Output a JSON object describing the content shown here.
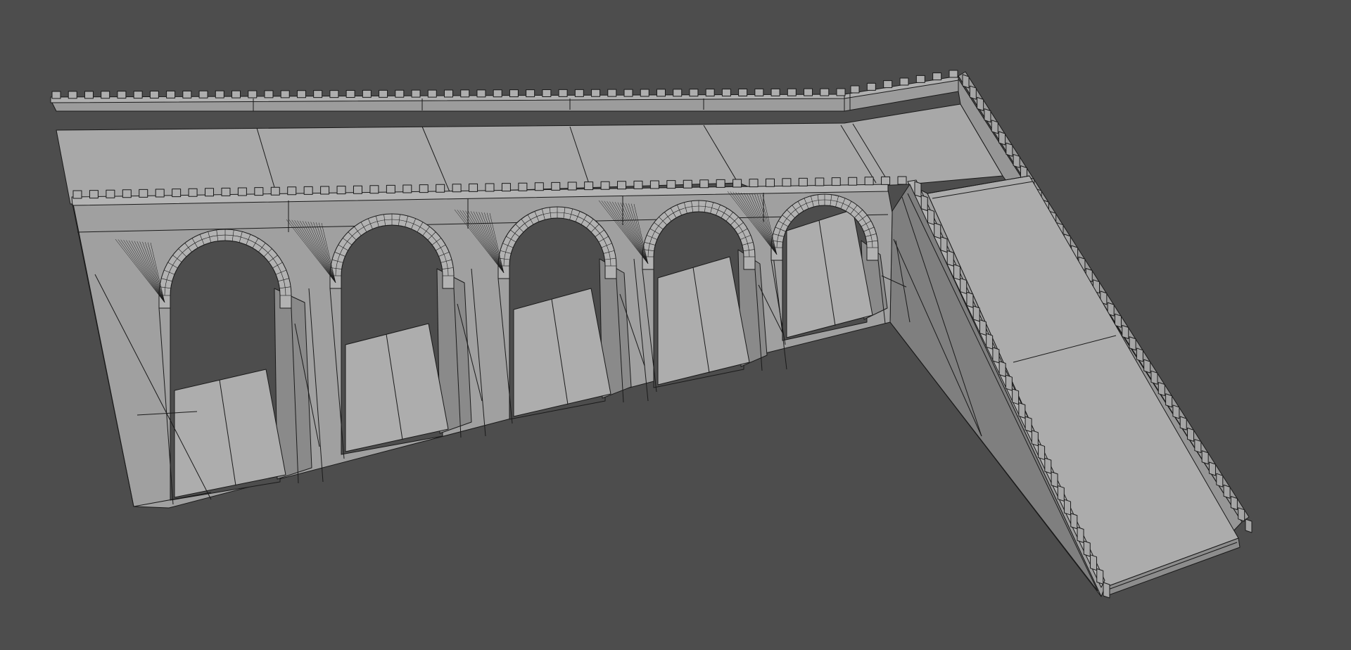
{
  "viewport": {
    "background_color": "#4d4d4d",
    "surface_color": "#a4a4a4",
    "shadow_color": "#7e7e7e",
    "wireframe_color": "#1a1a1a",
    "display_mode": "shaded-wireframe",
    "model": {
      "name": "castle-wall-arcade-with-ramp",
      "arch_count": 5,
      "parts": [
        "upper-walkway",
        "arcade-wall",
        "arches",
        "side-wall",
        "ramp",
        "crenellations"
      ]
    }
  }
}
